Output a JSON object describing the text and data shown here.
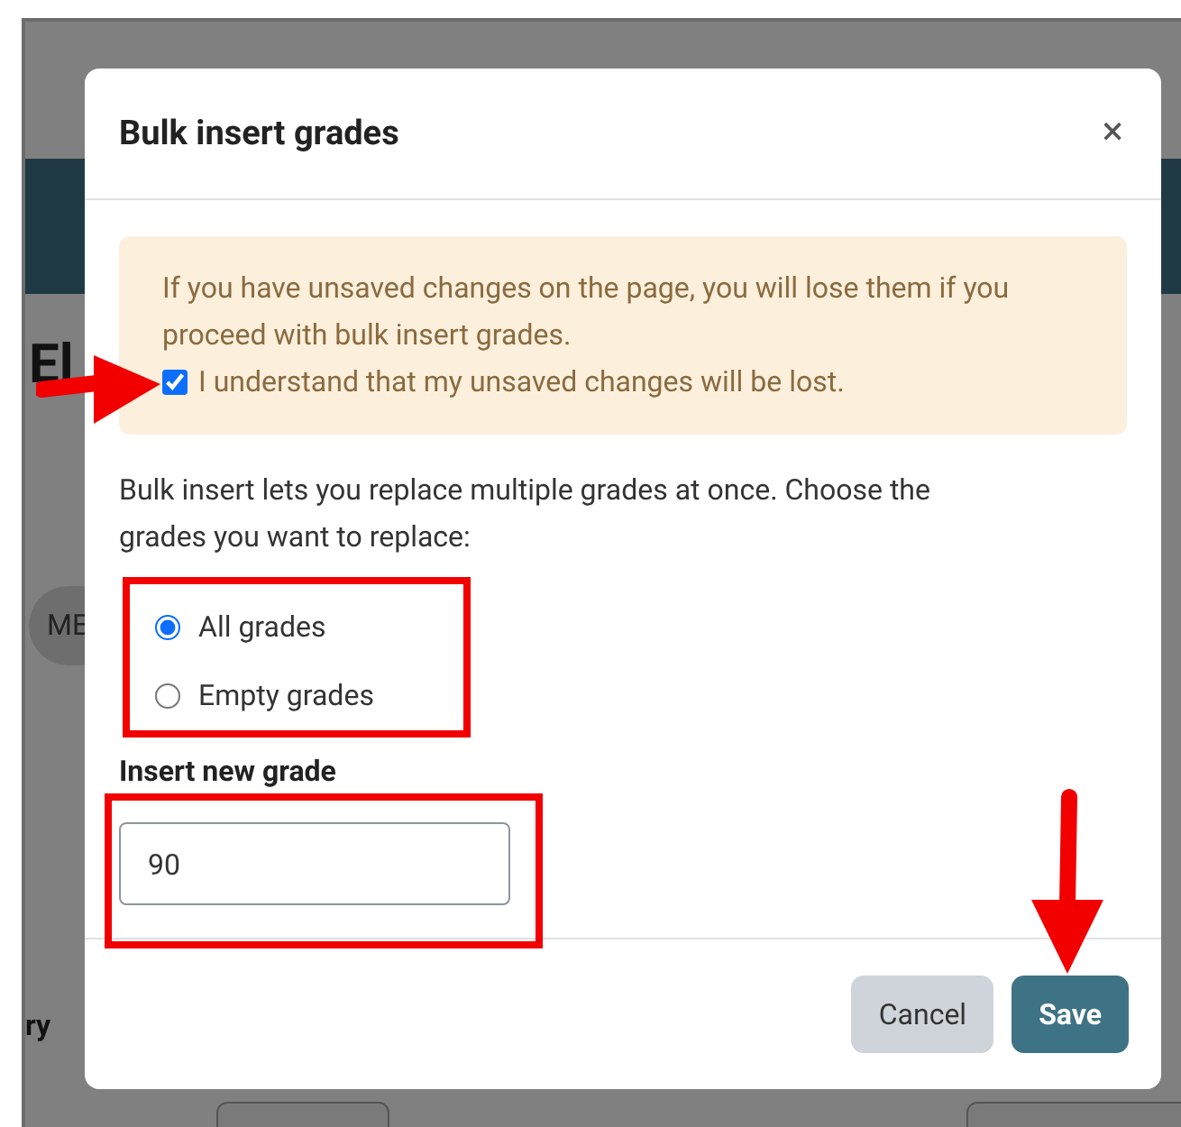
{
  "background": {
    "heading_fragment": "El",
    "chip_fragment": "ME",
    "label_fragment": "ry"
  },
  "modal": {
    "title": "Bulk insert grades",
    "close": "×",
    "alert": {
      "message": "If you have unsaved changes on the page, you will lose them if you proceed with bulk insert grades.",
      "confirm_label": "I understand that my unsaved changes will be lost.",
      "checked": true
    },
    "description": "Bulk insert lets you replace multiple grades at once. Choose the grades you want to replace:",
    "options": [
      {
        "label": "All grades",
        "selected": true
      },
      {
        "label": "Empty grades",
        "selected": false
      }
    ],
    "grade_label": "Insert new grade",
    "grade_value": "90",
    "buttons": [
      {
        "label": "Cancel",
        "kind": "secondary"
      },
      {
        "label": "Save",
        "kind": "primary"
      }
    ]
  }
}
